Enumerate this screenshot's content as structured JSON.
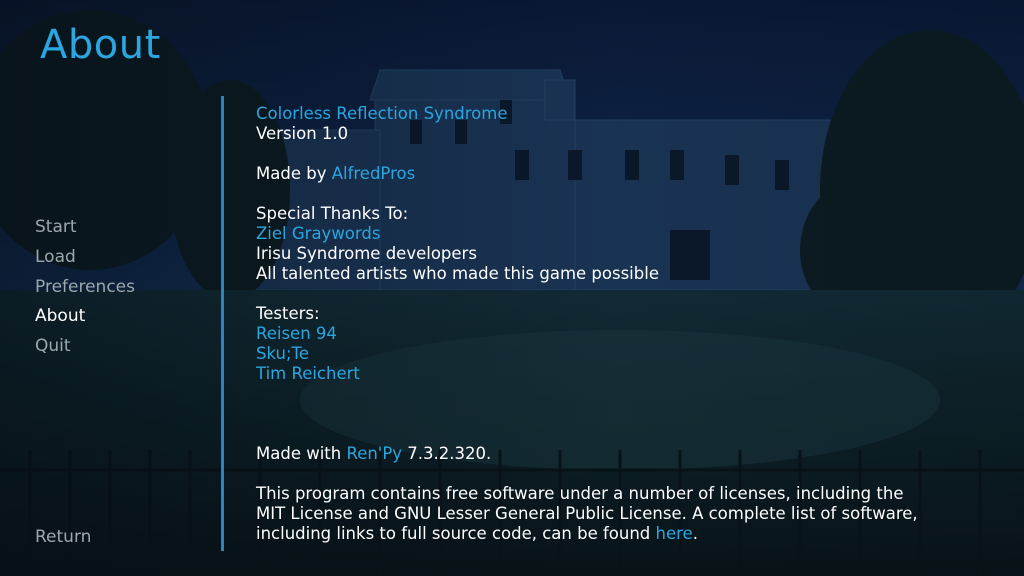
{
  "screen": {
    "title": "About"
  },
  "nav": {
    "items": [
      {
        "label": "Start"
      },
      {
        "label": "Load"
      },
      {
        "label": "Preferences"
      },
      {
        "label": "About"
      },
      {
        "label": "Quit"
      }
    ],
    "return_label": "Return"
  },
  "about": {
    "game_title": "Colorless Reflection Syndrome",
    "version": "Version 1.0",
    "made_by_prefix": "Made by ",
    "author": "AlfredPros",
    "thanks_heading": "Special Thanks To:",
    "thanks": [
      "Ziel Graywords",
      "Irisu Syndrome developers",
      "All talented artists who made this game possible"
    ],
    "testers_heading": "Testers:",
    "testers": [
      "Reisen 94",
      "Sku;Te",
      "Tim Reichert"
    ],
    "made_with_prefix": "Made with ",
    "engine_link": "Ren'Py",
    "engine_version": " 7.3.2.320.",
    "license_line1": "This program contains free software under a number of licenses, including the",
    "license_line2": "MIT License and GNU Lesser General Public License. A complete list of software,",
    "license_line3_prefix": "including links to full source code, can be found ",
    "license_link": "here",
    "license_line3_suffix": "."
  },
  "colors": {
    "accent": "#2aa6e0",
    "text": "#ffffff",
    "nav_idle": "#9da8ad",
    "divider": "#2a86c2"
  }
}
